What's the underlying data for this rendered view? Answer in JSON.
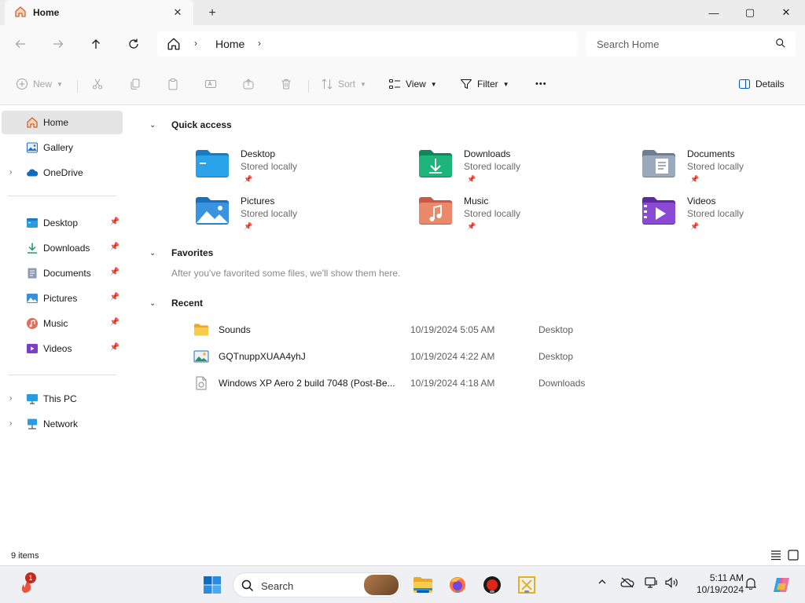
{
  "window": {
    "tab_title": "Home",
    "tab_icon": "home-icon",
    "new_tab": "+",
    "minimize": "—",
    "maximize": "▢",
    "close": "✕"
  },
  "address": {
    "breadcrumb": [
      "Home"
    ],
    "search_placeholder": "Search Home"
  },
  "commands": {
    "new": "New",
    "sort": "Sort",
    "view": "View",
    "filter": "Filter",
    "more": "•••",
    "details": "Details"
  },
  "sidebar": {
    "top": [
      {
        "label": "Home",
        "icon": "home-icon",
        "selected": true
      },
      {
        "label": "Gallery",
        "icon": "gallery-icon"
      },
      {
        "label": "OneDrive",
        "icon": "onedrive-icon",
        "expandable": true
      }
    ],
    "pinned": [
      {
        "label": "Desktop",
        "icon": "desktop-folder-icon"
      },
      {
        "label": "Downloads",
        "icon": "downloads-icon"
      },
      {
        "label": "Documents",
        "icon": "documents-icon"
      },
      {
        "label": "Pictures",
        "icon": "pictures-icon"
      },
      {
        "label": "Music",
        "icon": "music-icon"
      },
      {
        "label": "Videos",
        "icon": "videos-icon"
      }
    ],
    "bottom": [
      {
        "label": "This PC",
        "icon": "this-pc-icon",
        "expandable": true
      },
      {
        "label": "Network",
        "icon": "network-icon",
        "expandable": true
      }
    ]
  },
  "content": {
    "quick_access": {
      "title": "Quick access",
      "items": [
        {
          "name": "Desktop",
          "sub": "Stored locally",
          "icon": "desktop-folder-icon"
        },
        {
          "name": "Downloads",
          "sub": "Stored locally",
          "icon": "downloads-folder-icon"
        },
        {
          "name": "Documents",
          "sub": "Stored locally",
          "icon": "documents-folder-icon"
        },
        {
          "name": "Pictures",
          "sub": "Stored locally",
          "icon": "pictures-folder-icon"
        },
        {
          "name": "Music",
          "sub": "Stored locally",
          "icon": "music-folder-icon"
        },
        {
          "name": "Videos",
          "sub": "Stored locally",
          "icon": "videos-folder-icon"
        }
      ]
    },
    "favorites": {
      "title": "Favorites",
      "empty_text": "After you've favorited some files, we'll show them here."
    },
    "recent": {
      "title": "Recent",
      "items": [
        {
          "name": "Sounds",
          "date": "10/19/2024 5:05 AM",
          "location": "Desktop",
          "icon": "folder-icon"
        },
        {
          "name": "GQTnuppXUAA4yhJ",
          "date": "10/19/2024 4:22 AM",
          "location": "Desktop",
          "icon": "image-file-icon"
        },
        {
          "name": "Windows XP Aero 2 build 7048 (Post-Be...",
          "date": "10/19/2024 4:18 AM",
          "location": "Downloads",
          "icon": "document-file-icon"
        }
      ]
    }
  },
  "status": {
    "item_count": "9 items"
  },
  "taskbar": {
    "search_label": "Search",
    "notification_badge": "1",
    "time": "5:11 AM",
    "date": "10/19/2024"
  },
  "colors": {
    "accent": "#005fb8",
    "folder_yellow": "#f4c542",
    "selection": "#e5e5e5"
  }
}
